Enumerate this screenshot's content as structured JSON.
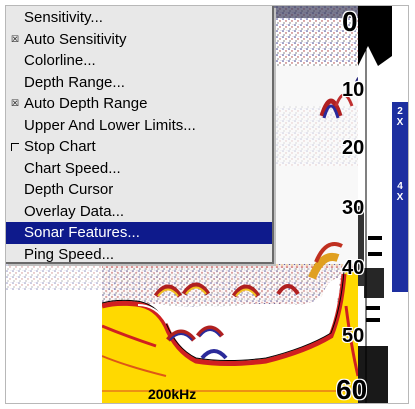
{
  "menu": {
    "items": [
      {
        "label": "Sensitivity...",
        "check": "",
        "selected": false
      },
      {
        "label": "Auto Sensitivity",
        "check": "x",
        "selected": false
      },
      {
        "label": "Colorline...",
        "check": "",
        "selected": false
      },
      {
        "label": "Depth Range...",
        "check": "",
        "selected": false
      },
      {
        "label": "Auto Depth Range",
        "check": "x",
        "selected": false
      },
      {
        "label": "Upper And Lower Limits...",
        "check": "",
        "selected": false
      },
      {
        "label": "Stop Chart",
        "check": "box",
        "selected": false
      },
      {
        "label": "Chart Speed...",
        "check": "",
        "selected": false
      },
      {
        "label": "Depth Cursor",
        "check": "",
        "selected": false
      },
      {
        "label": "Overlay Data...",
        "check": "",
        "selected": false
      },
      {
        "label": "Sonar Features...",
        "check": "",
        "selected": true
      },
      {
        "label": "Ping Speed...",
        "check": "",
        "selected": false
      }
    ]
  },
  "depth_scale": {
    "labels": [
      "0",
      "10",
      "20",
      "30",
      "40",
      "50",
      "60"
    ]
  },
  "zoom": {
    "levels": [
      {
        "top": "2",
        "bottom": "X"
      },
      {
        "top": "4",
        "bottom": "X"
      }
    ]
  },
  "frequency": "200kHz",
  "icons": {
    "checked": "x-check-icon",
    "unchecked": "empty-check-icon"
  },
  "colors": {
    "menu_bg": "#e8e8e8",
    "highlight": "#0e1a8c",
    "zoom_bar": "#1d2fa0",
    "bottom_return": "#ffd700"
  }
}
